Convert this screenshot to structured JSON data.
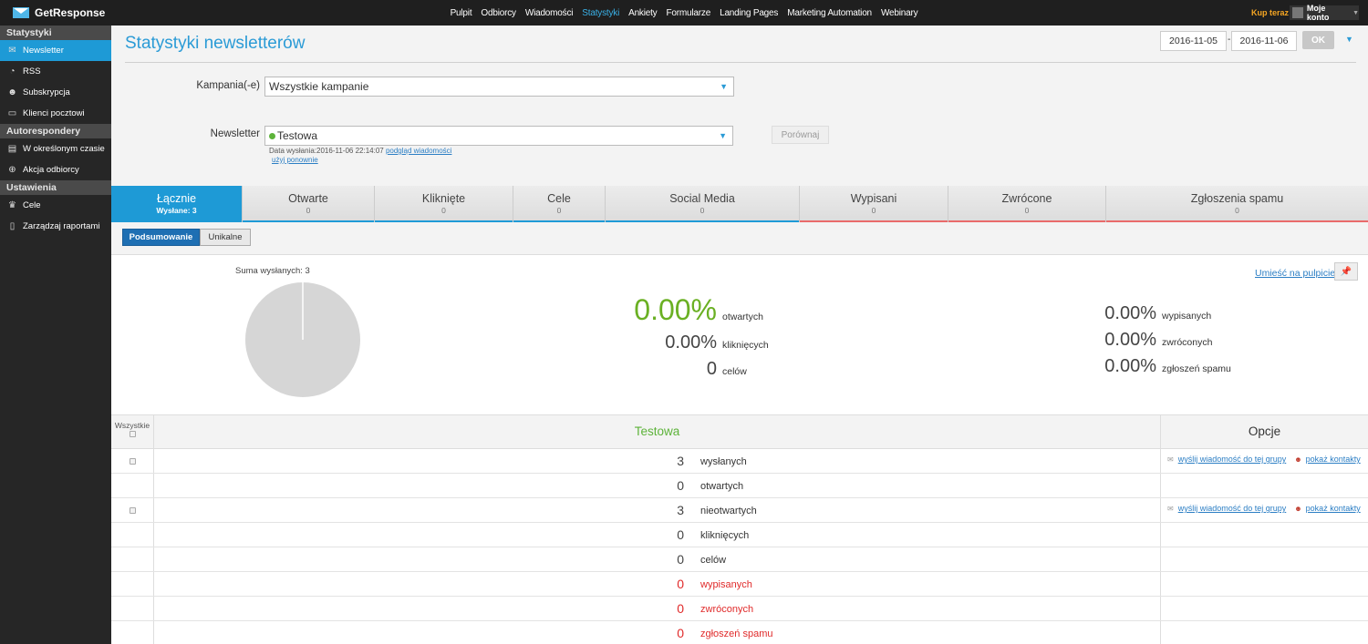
{
  "brand": "GetResponse",
  "topnav": [
    "Pulpit",
    "Odbiorcy",
    "Wiadomości",
    "Statystyki",
    "Ankiety",
    "Formularze",
    "Landing Pages",
    "Marketing Automation",
    "Webinary"
  ],
  "topnav_active": "Statystyki",
  "buy_now": "Kup teraz",
  "account": "Moje konto",
  "sidebar": {
    "sections": [
      {
        "title": "Statystyki",
        "items": [
          {
            "label": "Newsletter",
            "icon": "envelope-icon",
            "active": true
          },
          {
            "label": "RSS",
            "icon": "rss-icon"
          },
          {
            "label": "Subskrypcja",
            "icon": "user-icon"
          },
          {
            "label": "Klienci pocztowi",
            "icon": "laptop-icon"
          }
        ]
      },
      {
        "title": "Autorespondery",
        "items": [
          {
            "label": "W określonym czasie",
            "icon": "calendar-icon"
          },
          {
            "label": "Akcja odbiorcy",
            "icon": "plus-circle-icon"
          }
        ]
      },
      {
        "title": "Ustawienia",
        "items": [
          {
            "label": "Cele",
            "icon": "trophy-icon"
          },
          {
            "label": "Zarządzaj raportami",
            "icon": "document-icon"
          }
        ]
      }
    ]
  },
  "header": {
    "title": "Statystyki newsletterów",
    "date_from": "2016-11-05",
    "date_sep": "-",
    "date_to": "2016-11-06",
    "ok": "OK"
  },
  "filters": {
    "campaign_label": "Kampania(-e)",
    "campaign_value": "Wszystkie kampanie",
    "newsletter_label": "Newsletter",
    "newsletter_value": "Testowa",
    "compare": "Porównaj",
    "sent_date": "Data wysłania:2016-11-06 22:14:07",
    "preview_link": "podgląd wiadomości",
    "reuse_link": "użyj ponownie"
  },
  "tabs": [
    {
      "label": "Łącznie",
      "sub": "Wysłane: 3",
      "active": true
    },
    {
      "label": "Otwarte",
      "sub": "0"
    },
    {
      "label": "Kliknięte",
      "sub": "0"
    },
    {
      "label": "Cele",
      "sub": "0"
    },
    {
      "label": "Social Media",
      "sub": "0"
    },
    {
      "label": "Wypisani",
      "sub": "0"
    },
    {
      "label": "Zwrócone",
      "sub": "0"
    },
    {
      "label": "Zgłoszenia spamu",
      "sub": "0"
    }
  ],
  "toggle": {
    "summary": "Podsumowanie",
    "unique": "Unikalne"
  },
  "summary": {
    "total_sent": "Suma wysłanych: 3",
    "pin_link": "Umieść na pulpicie",
    "left_stats": [
      {
        "value": "0.00%",
        "label": "otwartych"
      },
      {
        "value": "0.00%",
        "label": "kliknięcych"
      },
      {
        "value": "0",
        "label": "celów"
      }
    ],
    "right_stats": [
      {
        "value": "0.00%",
        "label": "wypisanych"
      },
      {
        "value": "0.00%",
        "label": "zwróconych"
      },
      {
        "value": "0.00%",
        "label": "zgłoszeń spamu"
      }
    ]
  },
  "table": {
    "col_all": "Wszystkie",
    "col_newsletter": "Testowa",
    "col_options": "Opcje",
    "send_link": "wyślij wiadomość do tej grupy",
    "contacts_link": "pokaż kontakty",
    "rows": [
      {
        "value": "3",
        "label": "wysłanych"
      },
      {
        "value": "0",
        "label": "otwartych"
      },
      {
        "value": "3",
        "label": "nieotwartych"
      },
      {
        "value": "0",
        "label": "kliknięcych"
      },
      {
        "value": "0",
        "label": "celów"
      },
      {
        "value": "0",
        "label": "wypisanych"
      },
      {
        "value": "0",
        "label": "zwróconych"
      },
      {
        "value": "0",
        "label": "zgłoszeń spamu"
      }
    ]
  },
  "colors": {
    "accent": "#1e9ad6",
    "green": "#6ab023",
    "red": "#e02a2a"
  }
}
